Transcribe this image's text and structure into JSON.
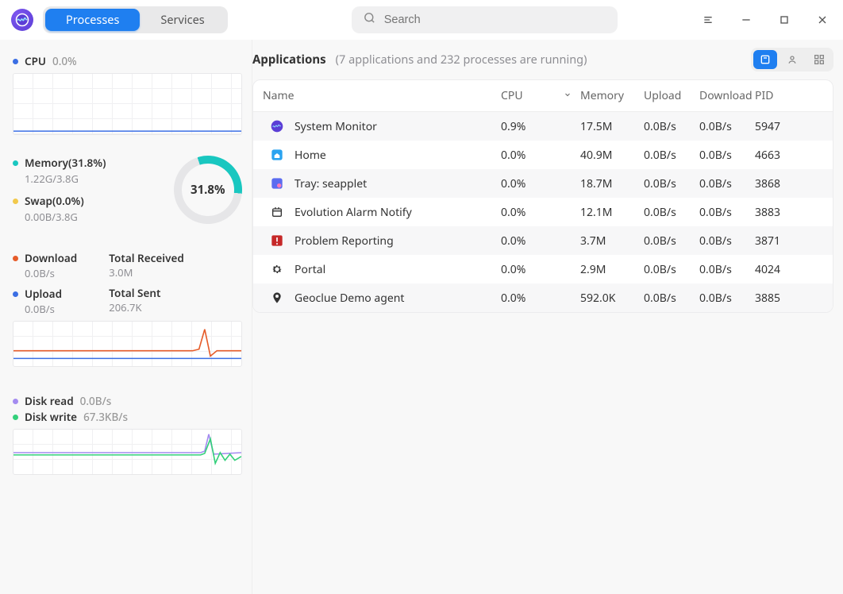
{
  "tabs": {
    "processes": "Processes",
    "services": "Services"
  },
  "search": {
    "placeholder": "Search"
  },
  "sidebar": {
    "cpu": {
      "label": "CPU",
      "value": "0.0%",
      "color": "#3b6fe4"
    },
    "memory": {
      "label": "Memory(31.8%)",
      "detail": "1.22G/3.8G",
      "color": "#19c7c0",
      "donut": "31.8%"
    },
    "swap": {
      "label": "Swap(0.0%)",
      "detail": "0.00B/3.8G",
      "color": "#f2c94c"
    },
    "download": {
      "label": "Download",
      "rate": "0.0B/s",
      "color": "#e65c2a"
    },
    "upload": {
      "label": "Upload",
      "rate": "0.0B/s",
      "color": "#3b6fe4"
    },
    "total_received": {
      "label": "Total Received",
      "value": "3.0M"
    },
    "total_sent": {
      "label": "Total Sent",
      "value": "206.7K"
    },
    "disk_read": {
      "label": "Disk read",
      "rate": "0.0B/s",
      "color": "#a48cf0"
    },
    "disk_write": {
      "label": "Disk write",
      "rate": "67.3KB/s",
      "color": "#34d07b"
    }
  },
  "main": {
    "title": "Applications",
    "subtitle": "(7 applications and 232 processes are running)",
    "columns": {
      "name": "Name",
      "cpu": "CPU",
      "memory": "Memory",
      "upload": "Upload",
      "download": "Download",
      "pid": "PID"
    },
    "rows": [
      {
        "name": "System Monitor",
        "cpu": "0.9%",
        "memory": "17.5M",
        "upload": "0.0B/s",
        "download": "0.0B/s",
        "pid": "5947",
        "icon": "monitor"
      },
      {
        "name": "Home",
        "cpu": "0.0%",
        "memory": "40.9M",
        "upload": "0.0B/s",
        "download": "0.0B/s",
        "pid": "4663",
        "icon": "home"
      },
      {
        "name": "Tray: seapplet",
        "cpu": "0.0%",
        "memory": "18.7M",
        "upload": "0.0B/s",
        "download": "0.0B/s",
        "pid": "3868",
        "icon": "tray"
      },
      {
        "name": "Evolution Alarm Notify",
        "cpu": "0.0%",
        "memory": "12.1M",
        "upload": "0.0B/s",
        "download": "0.0B/s",
        "pid": "3883",
        "icon": "alarm"
      },
      {
        "name": "Problem Reporting",
        "cpu": "0.0%",
        "memory": "3.7M",
        "upload": "0.0B/s",
        "download": "0.0B/s",
        "pid": "3871",
        "icon": "warn"
      },
      {
        "name": "Portal",
        "cpu": "0.0%",
        "memory": "2.9M",
        "upload": "0.0B/s",
        "download": "0.0B/s",
        "pid": "4024",
        "icon": "gear"
      },
      {
        "name": "Geoclue Demo agent",
        "cpu": "0.0%",
        "memory": "592.0K",
        "upload": "0.0B/s",
        "download": "0.0B/s",
        "pid": "3885",
        "icon": "pin"
      }
    ]
  }
}
